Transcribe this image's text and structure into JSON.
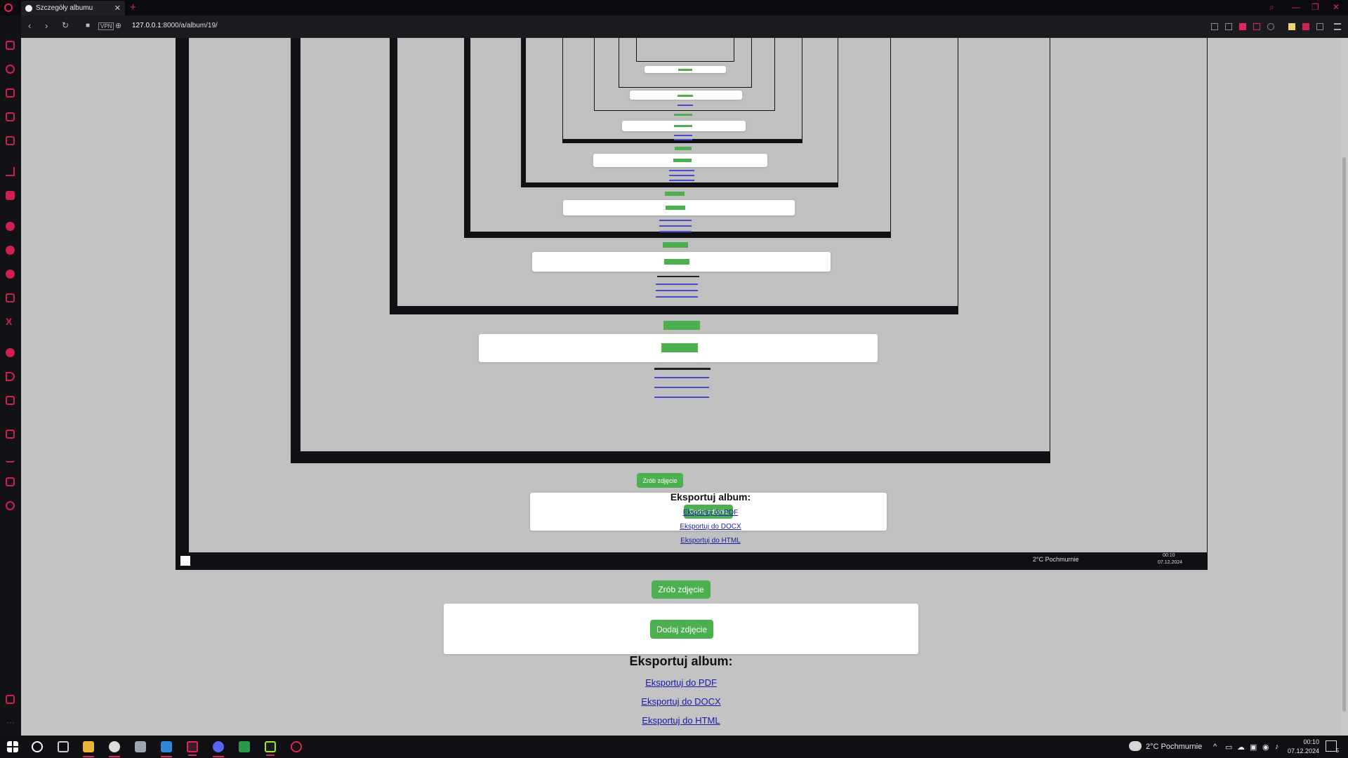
{
  "browser": {
    "tab_title": "Szczegóły albumu",
    "tab_close": "✕",
    "new_tab": "+",
    "url_host": "127.0.0.1",
    "url_path": ":8000/a/album/19/",
    "vpn_badge": "VPN",
    "accent": "#e0245e"
  },
  "page": {
    "take_photo_label": "Zrób zdjęcie",
    "add_photo_label": "Dodaj zdjęcie",
    "export_title": "Eksportuj album:",
    "export_links": [
      {
        "label": "Eksportuj do PDF"
      },
      {
        "label": "Eksportuj do DOCX"
      },
      {
        "label": "Eksportuj do HTML"
      }
    ],
    "button_color": "#4caf50"
  },
  "embedded_screenshot": {
    "weather": "2°C Pochmurnie",
    "time": "00:10",
    "date": "07.12.2024",
    "take_photo_label": "Zrób zdjęcie",
    "add_photo_label": "Dodaj zdjęcie",
    "export_title": "Eksportuj album:",
    "export_links": [
      {
        "label": "Eksportuj do PDF"
      },
      {
        "label": "Eksportuj do DOCX"
      },
      {
        "label": "Eksportuj do HTML"
      }
    ]
  },
  "taskbar": {
    "weather": "2°C Pochmurnie",
    "time": "00:10",
    "date": "07.12.2024",
    "notification_count": "5"
  }
}
